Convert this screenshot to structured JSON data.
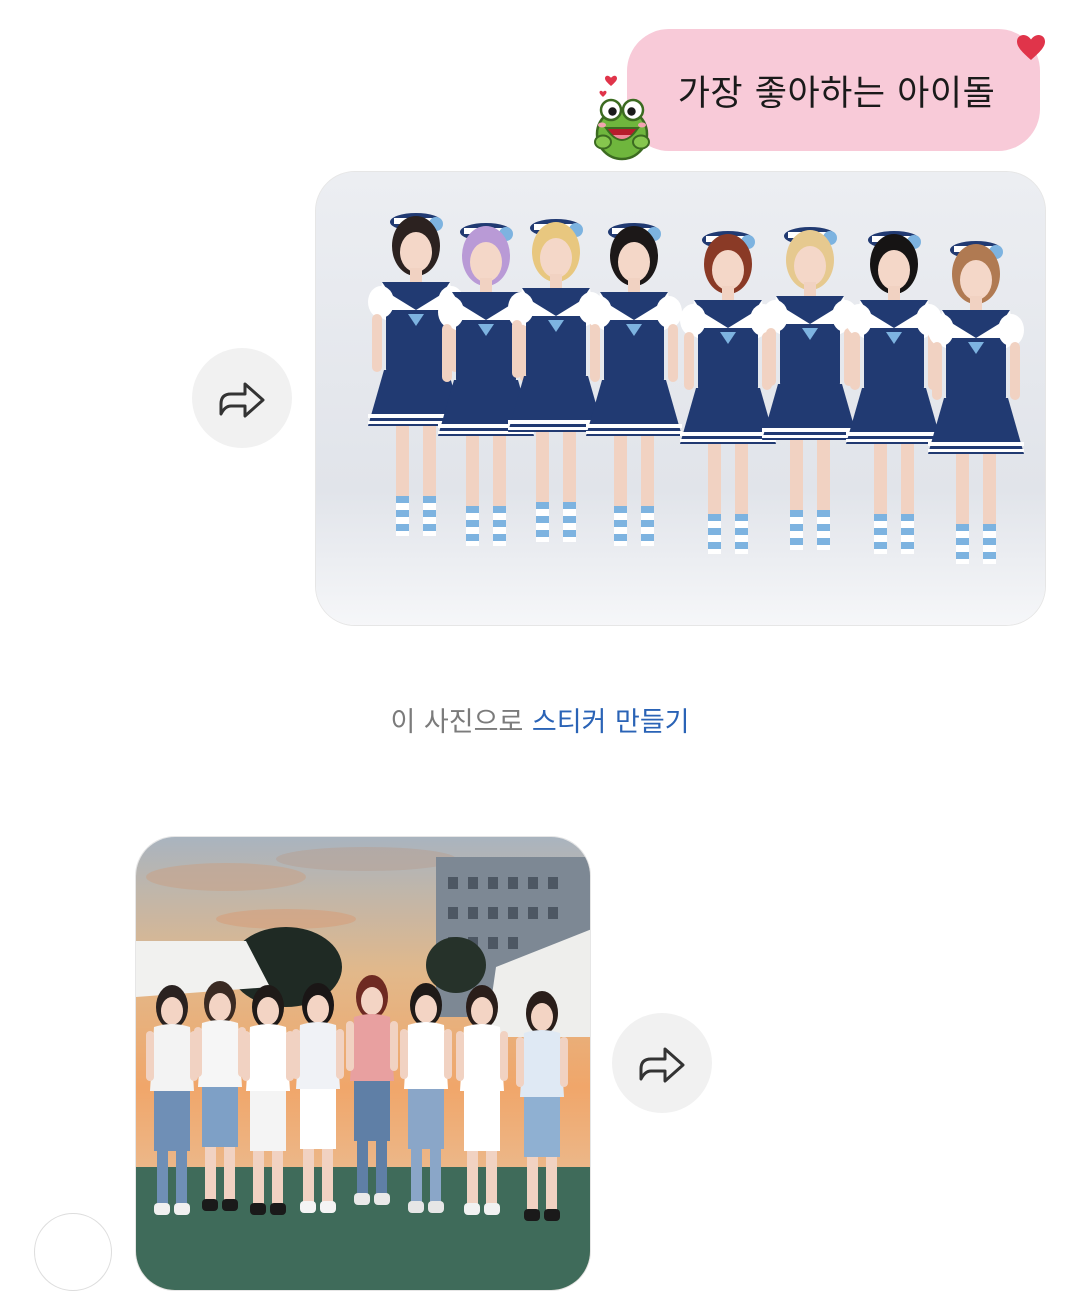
{
  "chat": {
    "sent_text": "가장 좋아하는 아이돌",
    "sticker_prompt": {
      "static_text": "이 사진으로 ",
      "link_text": "스티커 만들기"
    }
  },
  "icons": {
    "bubble_decoration": "heart-icon",
    "sticker": "frog-sticker-icon",
    "share": "share-arrow-icon"
  },
  "colors": {
    "bubble": "#f8cad8",
    "link": "#2a63b6",
    "heart": "#e0344a",
    "uniform_navy": "#213a72",
    "uniform_light_blue": "#7db3e0"
  }
}
